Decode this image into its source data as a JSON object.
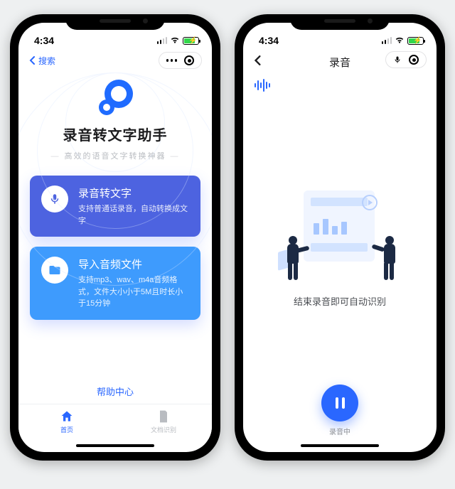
{
  "status": {
    "time": "4:34",
    "back_search": "搜索"
  },
  "colors": {
    "primary": "#2a67ff",
    "card1": "#4d63e0",
    "card2": "#3e9bfd"
  },
  "screen1": {
    "app_title": "录音转文字助手",
    "app_subtitle": "高效的语音文字转换神器",
    "card_record": {
      "title": "录音转文字",
      "desc": "支持普通话录音，自动转换成文字"
    },
    "card_import": {
      "title": "导入音频文件",
      "desc": "支持mp3、wav、m4a音频格式，文件大小小于5M且时长小于15分钟"
    },
    "help_link": "帮助中心",
    "tabs": {
      "home": "首页",
      "doc": "文档识别"
    }
  },
  "screen2": {
    "title": "录音",
    "caption": "结束录音即可自动识别",
    "rec_label": "录音中"
  }
}
